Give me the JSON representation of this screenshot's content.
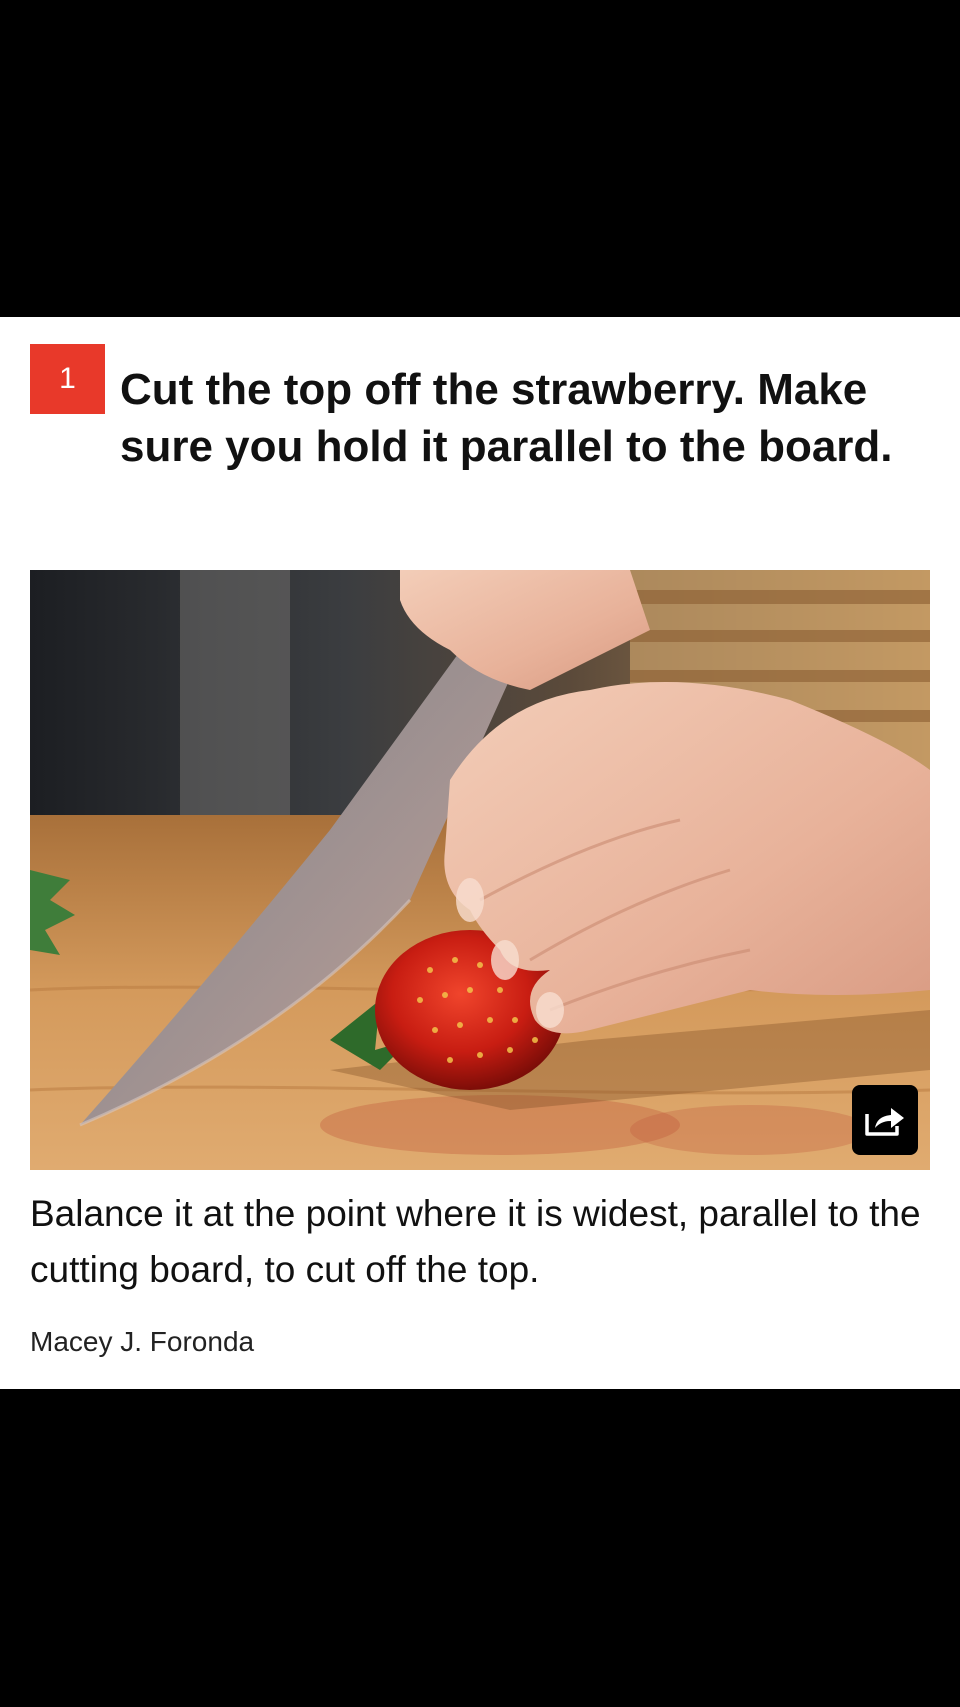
{
  "colors": {
    "page_background": "#000000",
    "card_background": "#ffffff",
    "step_badge": "#e8392a",
    "share_button": "#000000",
    "text": "#111111"
  },
  "step": {
    "number": "1",
    "title": "Cut the top off the strawberry. Make sure you hold it parallel to the board."
  },
  "photo": {
    "subject": "hand slicing strawberry with chef knife on wooden cutting board",
    "share_icon": "share-arrow-icon"
  },
  "caption": "Balance it at the point where it is widest, parallel to the cutting board, to cut off the top.",
  "credit": "Macey J. Foronda"
}
